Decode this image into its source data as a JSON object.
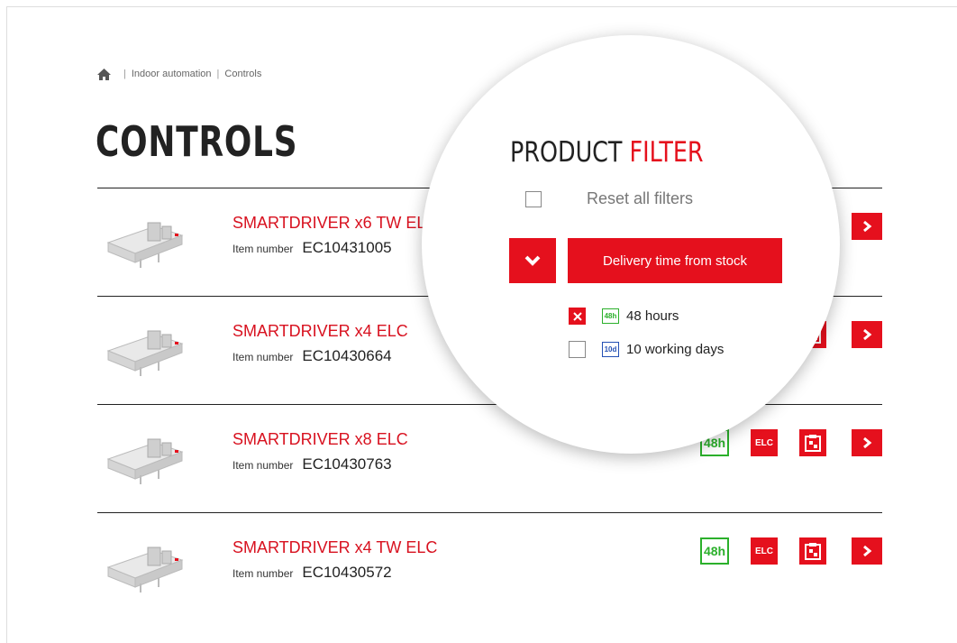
{
  "breadcrumb": {
    "home_icon": "home-icon",
    "items": [
      "Indoor automation",
      "Controls"
    ],
    "separator": "|"
  },
  "page": {
    "title": "CONTROLS"
  },
  "colors": {
    "accent": "#e5101d",
    "green": "#2bb02b",
    "blue": "#2450b4"
  },
  "products": [
    {
      "name": "SMARTDRIVER x6 TW ELC",
      "item_label": "Item number",
      "item_number": "EC10431005"
    },
    {
      "name": "SMARTDRIVER x4 ELC",
      "item_label": "Item number",
      "item_number": "EC10430664"
    },
    {
      "name": "SMARTDRIVER x8 ELC",
      "item_label": "Item number",
      "item_number": "EC10430763"
    },
    {
      "name": "SMARTDRIVER x4 TW ELC",
      "item_label": "Item number",
      "item_number": "EC10430572"
    }
  ],
  "badges": {
    "delivery": "48h",
    "elc": "ELC"
  },
  "filter": {
    "title_part1": "PRODUCT",
    "title_part2": "FILTER",
    "reset_label": "Reset all filters",
    "group_label": "Delivery time from stock",
    "options": [
      {
        "tag": "48h",
        "label": "48 hours",
        "checked": true
      },
      {
        "tag": "10d",
        "label": "10 working days",
        "checked": false
      }
    ]
  }
}
